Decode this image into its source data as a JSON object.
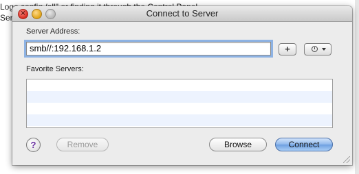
{
  "background": {
    "line1": "Logo config /all\" or finding it through the Control Panel",
    "line2": "Ser"
  },
  "window": {
    "title": "Connect to Server",
    "close_glyph": "×",
    "min_glyph": "",
    "max_glyph": ""
  },
  "server_address": {
    "label": "Server Address:",
    "value": "smb//:192.168.1.2"
  },
  "actions": {
    "add": "+",
    "recent_icon": "clock-icon"
  },
  "favorites": {
    "label": "Favorite Servers:",
    "items": []
  },
  "buttons": {
    "help": "?",
    "remove": "Remove",
    "browse": "Browse",
    "connect": "Connect"
  },
  "colors": {
    "focus_ring": "#8db2e3",
    "default_button": "#8fb8ec",
    "list_stripe": "#edf3fe"
  }
}
